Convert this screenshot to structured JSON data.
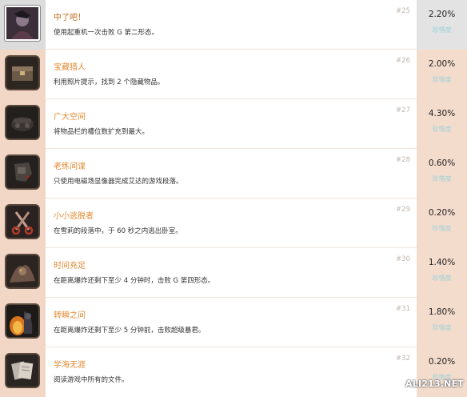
{
  "achievements": [
    {
      "title": "中了吧！",
      "desc": "使用起重机一次击败 G 第二形态。",
      "num": "#25",
      "pct": "2.20%",
      "rarity": "珍惜度",
      "icon": "character-portrait-icon"
    },
    {
      "title": "宝藏猎人",
      "desc": "利用照片提示，找到 2 个隐藏物品。",
      "num": "#26",
      "pct": "2.00%",
      "rarity": "珍惜度",
      "icon": "treasure-chest-icon"
    },
    {
      "title": "广大空间",
      "desc": "将物品栏的槽位数扩充到最大。",
      "num": "#27",
      "pct": "4.30%",
      "rarity": "珍惜度",
      "icon": "hip-pouch-icon"
    },
    {
      "title": "老练间谍",
      "desc": "只使用电磁场显像器完成艾达的游戏段落。",
      "num": "#28",
      "pct": "0.60%",
      "rarity": "珍惜度",
      "icon": "emf-visualizer-icon"
    },
    {
      "title": "小小逃脱者",
      "desc": "在雪莉的段落中，于 60 秒之内逃出卧室。",
      "num": "#29",
      "pct": "0.20%",
      "rarity": "珍惜度",
      "icon": "scissors-icon"
    },
    {
      "title": "时间充足",
      "desc": "在距离爆炸还剩下至少 4 分钟时，击败 G 第四形态。",
      "num": "#30",
      "pct": "1.40%",
      "rarity": "珍惜度",
      "icon": "monster-icon"
    },
    {
      "title": "转瞬之间",
      "desc": "在距离爆炸还剩下至少 5 分钟前，击败超级暴君。",
      "num": "#31",
      "pct": "1.80%",
      "rarity": "珍惜度",
      "icon": "tyrant-fire-icon"
    },
    {
      "title": "学海无涯",
      "desc": "阅读游戏中所有的文件。",
      "num": "#32",
      "pct": "0.20%",
      "rarity": "珍惜度",
      "icon": "documents-icon"
    }
  ],
  "watermark": "ALI213.NET"
}
